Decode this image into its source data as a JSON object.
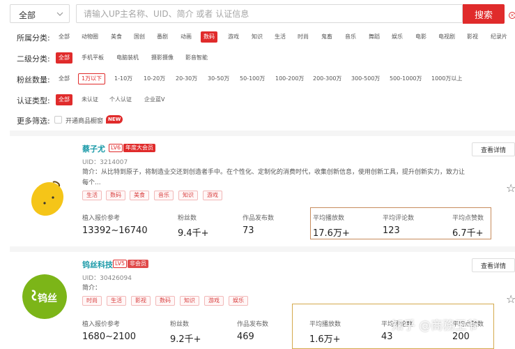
{
  "search": {
    "scope_value": "全部",
    "placeholder": "请输入UP主名称、UID、简介 或者 认证信息",
    "button_label": "搜索",
    "clear_label": "清"
  },
  "filters": {
    "category": {
      "label": "所属分类:",
      "options": [
        "全部",
        "动物圈",
        "美食",
        "国创",
        "番剧",
        "动画",
        "数码",
        "游戏",
        "知识",
        "生活",
        "时尚",
        "鬼畜",
        "音乐",
        "舞蹈",
        "娱乐",
        "电影",
        "电视剧",
        "影视",
        "纪录片"
      ],
      "selected": "数码"
    },
    "sub_category": {
      "label": "二级分类:",
      "options": [
        "全部",
        "手机平板",
        "电脑装机",
        "摄影摄像",
        "影音智能"
      ],
      "selected": "全部"
    },
    "fans": {
      "label": "粉丝数量:",
      "options": [
        "全部",
        "1万以下",
        "1-10万",
        "10-20万",
        "20-30万",
        "30-50万",
        "50-100万",
        "100-200万",
        "200-300万",
        "300-500万",
        "500-1000万",
        "1000万以上"
      ],
      "selected": "1万以下"
    },
    "verify": {
      "label": "认证类型:",
      "options": [
        "全部",
        "未认证",
        "个人认证",
        "企业蓝V"
      ],
      "selected": "全部"
    },
    "more": {
      "label": "更多筛选:",
      "checkbox_label": "开通商品橱窗",
      "badge": "NEW"
    }
  },
  "cards": [
    {
      "name": "蔡子尤",
      "level": "LV6",
      "membership": "年度大会员",
      "uid": "UID：3214007",
      "intro_line1": "简介：从比特到原子，将制造业交还到创造者手中。在个性化、定制化的消费时代，收集创新信息，使用创新工具，提升创新实力，致力让",
      "intro_line2": "每个...",
      "tags": [
        "生活",
        "数码",
        "美食",
        "音乐",
        "知识",
        "游戏"
      ],
      "detail_label": "查看详情",
      "stats": [
        {
          "label": "植入报价参考",
          "value": "13392~16740"
        },
        {
          "label": "粉丝数",
          "value": "9.4千+"
        },
        {
          "label": "作品发布数",
          "value": "73"
        },
        {
          "label": "平均播放数",
          "value": "17.6万+"
        },
        {
          "label": "平均评论数",
          "value": "123"
        },
        {
          "label": "平均点赞数",
          "value": "6.7千+"
        }
      ]
    },
    {
      "name": "钨丝科技",
      "level": "LV5",
      "membership": "非会员",
      "uid": "UID：30426094",
      "intro_line1": "简介：",
      "intro_line2": "",
      "tags": [
        "时尚",
        "生活",
        "影视",
        "数码",
        "知识",
        "游戏",
        "娱乐"
      ],
      "detail_label": "查看详情",
      "logo_text": "钨丝",
      "stats": [
        {
          "label": "植入报价参考",
          "value": "1680~2100"
        },
        {
          "label": "粉丝数",
          "value": "9.2千+"
        },
        {
          "label": "作品发布数",
          "value": "469"
        },
        {
          "label": "平均播放数",
          "value": "1.6万+"
        },
        {
          "label": "平均评论数",
          "value": "43"
        },
        {
          "label": "平均点赞数",
          "value": "200"
        }
      ]
    }
  ],
  "watermark": "知乎 @商務王爷",
  "colors": {
    "accent": "#e02b2b",
    "name": "#1a9aa8",
    "highlight": "#c78b5c"
  }
}
